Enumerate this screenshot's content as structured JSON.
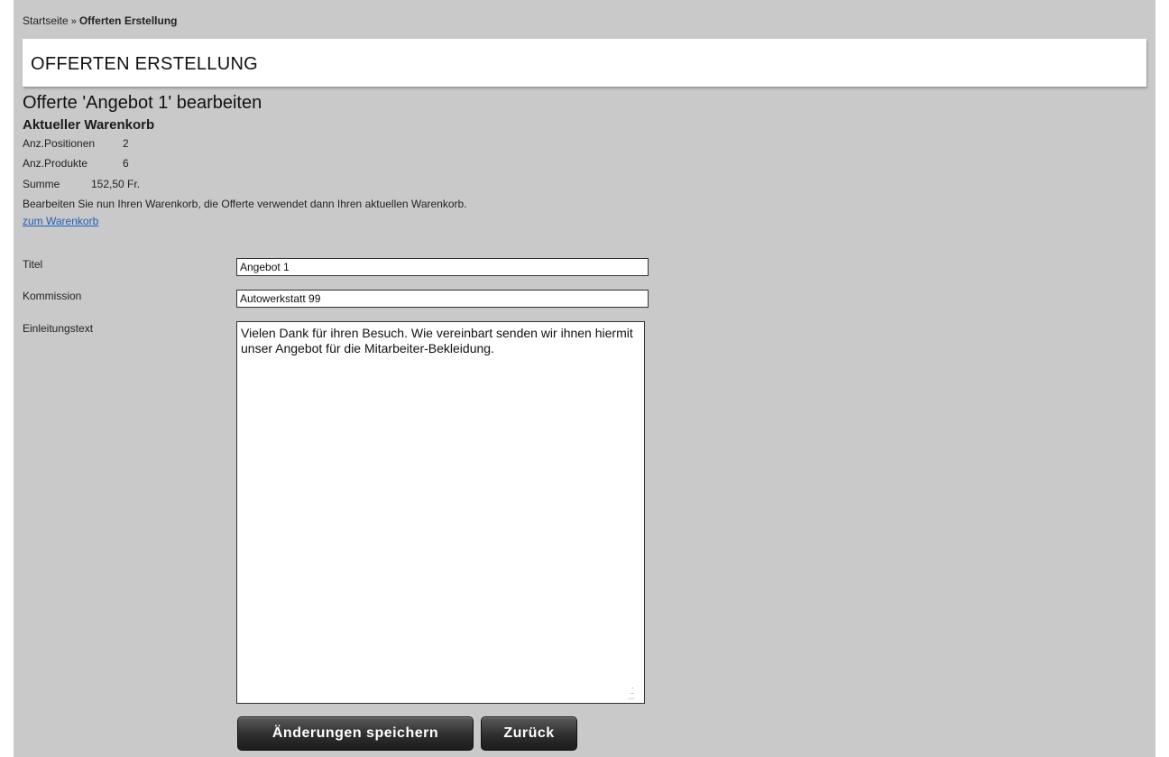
{
  "breadcrumb": {
    "home": "Startseite",
    "separator": "»",
    "current": "Offerten Erstellung"
  },
  "header": {
    "title": "OFFERTEN ERSTELLUNG"
  },
  "offer": {
    "edit_title": "Offerte 'Angebot 1' bearbeiten"
  },
  "cart": {
    "heading": "Aktueller Warenkorb",
    "positions_label": "Anz.Positionen",
    "positions_value": "2",
    "products_label": "Anz.Produkte",
    "products_value": "6",
    "sum_label": "Summe",
    "sum_value": "152,50 Fr.",
    "info_text": "Bearbeiten Sie nun Ihren Warenkorb, die Offerte verwendet dann Ihren aktuellen Warenkorb.",
    "link_text": "zum Warenkorb"
  },
  "form": {
    "title_label": "Titel",
    "title_value": "Angebot 1",
    "commission_label": "Kommission",
    "commission_value": "Autowerkstatt 99",
    "intro_label": "Einleitungstext",
    "intro_value": "Vielen Dank für ihren Besuch. Wie vereinbart senden wir ihnen hiermit unser Angebot für die Mitarbeiter-Bekleidung."
  },
  "buttons": {
    "save": "Änderungen speichern",
    "back": "Zurück"
  }
}
